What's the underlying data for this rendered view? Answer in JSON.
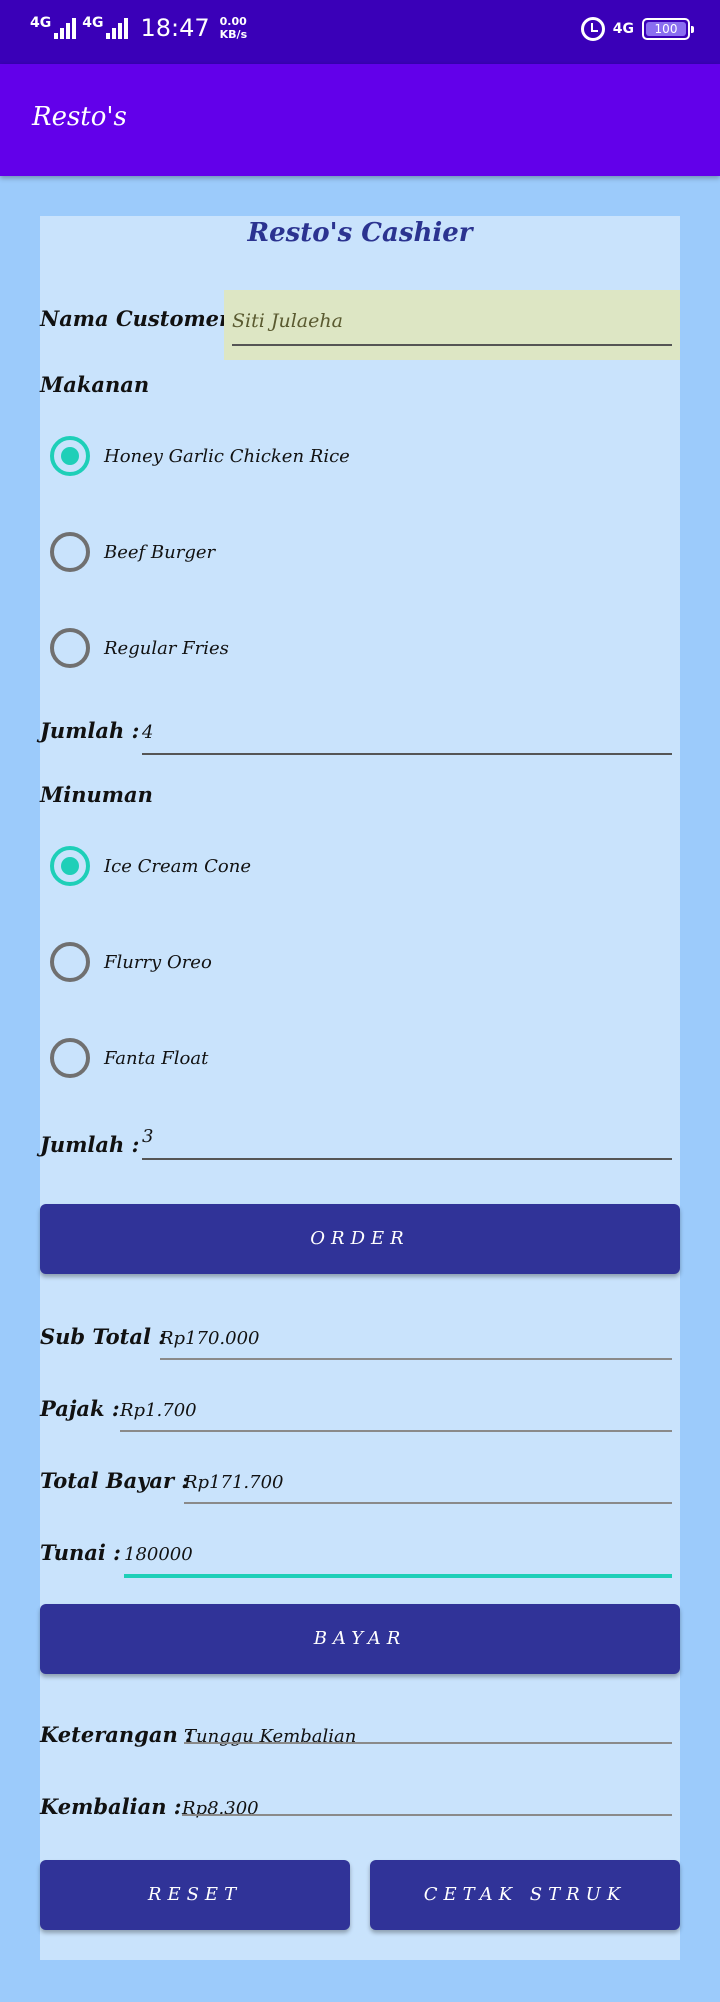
{
  "status_bar": {
    "network_1": "4G",
    "network_2": "4G",
    "time": "18:47",
    "speed_value": "0.00",
    "speed_unit": "KB/s",
    "network_right": "4G",
    "battery": "100"
  },
  "app": {
    "title": "Resto's"
  },
  "form": {
    "heading": "Resto's Cashier",
    "customer_label": "Nama Customer :",
    "customer_value": "Siti Julaeha",
    "makanan_label": "Makanan",
    "makanan_options": [
      {
        "label": "Honey Garlic Chicken Rice",
        "checked": true
      },
      {
        "label": "Beef Burger",
        "checked": false
      },
      {
        "label": "Regular Fries",
        "checked": false
      }
    ],
    "jumlah_makanan_label": "Jumlah :",
    "jumlah_makanan_value": "4",
    "minuman_label": "Minuman",
    "minuman_options": [
      {
        "label": "Ice Cream Cone",
        "checked": true
      },
      {
        "label": "Flurry Oreo",
        "checked": false
      },
      {
        "label": "Fanta Float",
        "checked": false
      }
    ],
    "jumlah_minuman_label": "Jumlah :",
    "jumlah_minuman_value": "3",
    "order_button": "ORDER",
    "subtotal_label": "Sub Total :",
    "subtotal_value": "Rp170.000",
    "pajak_label": "Pajak :",
    "pajak_value": "Rp1.700",
    "total_label": "Total Bayar :",
    "total_value": "Rp171.700",
    "tunai_label": "Tunai :",
    "tunai_value": "180000",
    "bayar_button": "BAYAR",
    "keterangan_label": "Keterangan :",
    "keterangan_value": "Tunggu Kembalian",
    "kembalian_label": "Kembalian :",
    "kembalian_value": "Rp8.300",
    "reset_button": "RESET",
    "cetak_button": "CETAK STRUK"
  },
  "colors": {
    "status_bar": "#3a00b8",
    "app_bar": "#6200ea",
    "background": "#9ccbfb",
    "card": "#c9e3fc",
    "button": "#303398",
    "accent": "#1ecfb8"
  }
}
